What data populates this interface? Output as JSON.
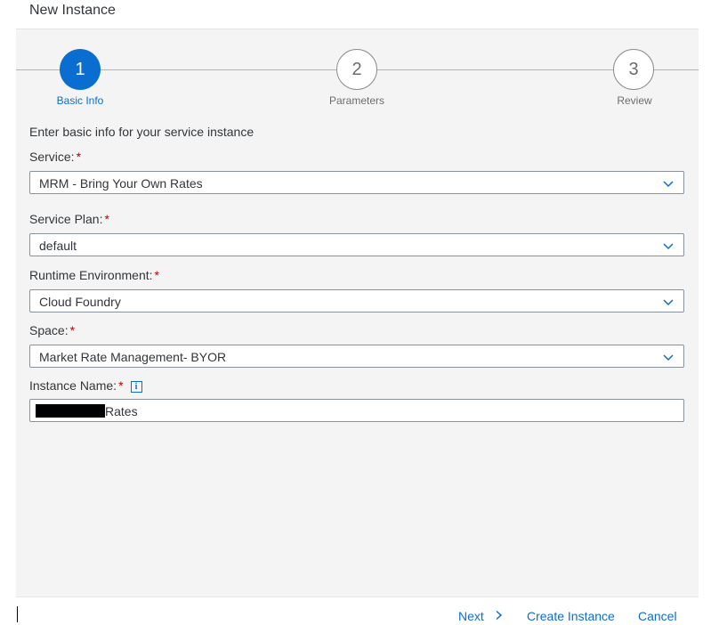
{
  "dialog": {
    "title": "New Instance"
  },
  "wizard": {
    "steps": [
      {
        "number": "1",
        "label": "Basic Info",
        "state": "active"
      },
      {
        "number": "2",
        "label": "Parameters",
        "state": "inactive"
      },
      {
        "number": "3",
        "label": "Review",
        "state": "inactive"
      }
    ]
  },
  "form": {
    "intro": "Enter basic info for your service instance",
    "required_marker": "*",
    "service": {
      "label": "Service:",
      "value": "MRM - Bring Your Own Rates"
    },
    "service_plan": {
      "label": "Service Plan:",
      "value": "default"
    },
    "runtime_environment": {
      "label": "Runtime Environment:",
      "value": "Cloud Foundry"
    },
    "space": {
      "label": "Space:",
      "value": "Market Rate Management- BYOR"
    },
    "instance_name": {
      "label": "Instance Name:",
      "value_suffix": "Rates",
      "info_icon": "i"
    }
  },
  "footer": {
    "next_label": "Next",
    "next_icon": "chevron-right-icon",
    "create_label": "Create Instance",
    "cancel_label": "Cancel"
  },
  "colors": {
    "accent": "#0a6ed1",
    "required": "#bb0000",
    "background": "#f4f4f4"
  }
}
